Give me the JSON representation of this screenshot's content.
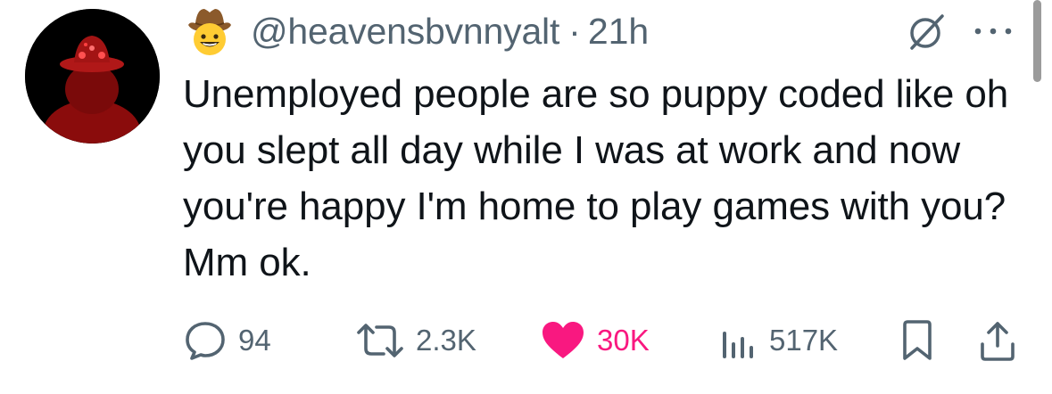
{
  "tweet": {
    "handle": "@heavensbvnnyalt",
    "separator": "·",
    "time": "21h",
    "text": "Unemployed people are so puppy coded like oh you slept all day while I was at work and now you're happy I'm home to play games with you? Mm ok."
  },
  "icons": {
    "avatar": "avatar",
    "badge": "cowboy-hat-face-emoji",
    "grok": "grok-icon",
    "more": "more-icon",
    "reply": "reply-icon",
    "repost": "repost-icon",
    "like": "heart-icon",
    "views": "views-icon",
    "bookmark": "bookmark-icon",
    "share": "share-icon"
  },
  "actions": {
    "replies": "94",
    "reposts": "2.3K",
    "likes": "30K",
    "views": "517K"
  },
  "colors": {
    "text": "#0f1419",
    "secondary": "#536471",
    "like": "#f91880"
  }
}
